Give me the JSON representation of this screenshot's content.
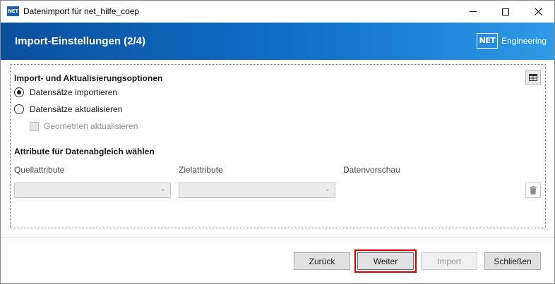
{
  "window": {
    "title": "Datenimport für net_hilfe_coep",
    "app_icon_text": "NET"
  },
  "banner": {
    "title": "Import-Einstellungen (2/4)",
    "brand_logo": "NET",
    "brand_text": "Engineering"
  },
  "import_options": {
    "title": "Import- und Aktualisierungsoptionen",
    "radio_import_label": "Datensätze importieren",
    "radio_import_selected": true,
    "radio_update_label": "Datensätze aktualisieren",
    "radio_update_selected": false,
    "geometry_checkbox_label": "Geometrien aktualisieren",
    "geometry_checkbox_checked": false,
    "geometry_checkbox_enabled": false
  },
  "attributes": {
    "title": "Attribute für Datenabgleich wählen",
    "source_header": "Quellattribute",
    "target_header": "Zielattribute",
    "preview_header": "Datenvorschau",
    "source_value": "",
    "target_value": ""
  },
  "buttons": {
    "back": "Zurück",
    "next": "Weiter",
    "import": "Import",
    "close": "Schließen"
  },
  "icons": {
    "table": "table-icon",
    "trash": "trash-icon",
    "dropdown": "chevron-down-icon"
  },
  "colors": {
    "banner_start": "#0a4f9c",
    "banner_end": "#2f9ae6",
    "highlight": "#d40000"
  }
}
